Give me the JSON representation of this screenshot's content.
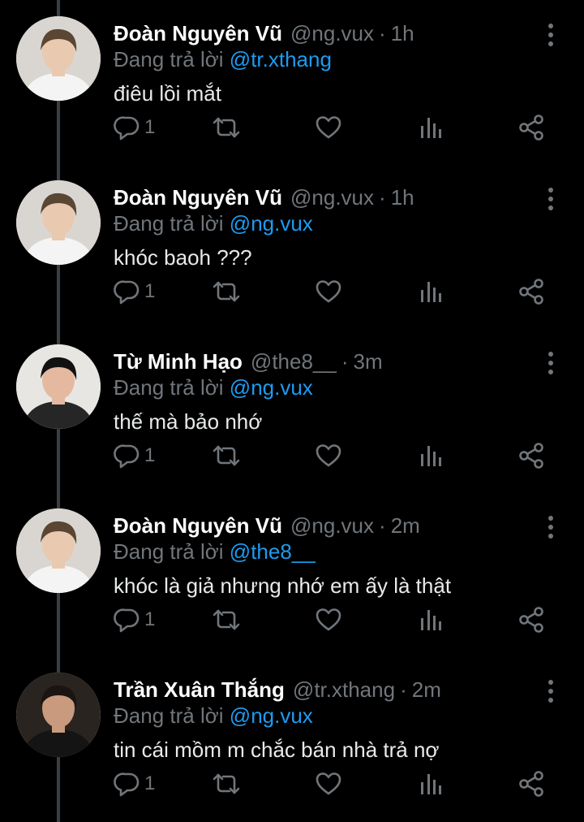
{
  "colors": {
    "background": "#000000",
    "accent": "#1d9bf0",
    "muted": "#71767b",
    "text": "#e7e9ea"
  },
  "icons": {
    "more": "more-vertical-icon",
    "reply": "reply-icon",
    "retweet": "retweet-icon",
    "like": "heart-icon",
    "stats": "analytics-icon",
    "share": "share-icon"
  },
  "reply_prefix": "Đang trả lời",
  "tweets": [
    {
      "name": "Đoàn Nguyên Vũ",
      "handle": "@ng.vux",
      "sep": "·",
      "time": "1h",
      "reply_to": "@tr.xthang",
      "text": "điêu lồi mắt",
      "reply_count": "1"
    },
    {
      "name": "Đoàn Nguyên Vũ",
      "handle": "@ng.vux",
      "sep": "·",
      "time": "1h",
      "reply_to": "@ng.vux",
      "text": "khóc baoh ???",
      "reply_count": "1"
    },
    {
      "name": "Từ Minh Hạo",
      "handle": "@the8__",
      "sep": "·",
      "time": "3m",
      "reply_to": "@ng.vux",
      "text": "thế mà bảo nhớ",
      "reply_count": "1"
    },
    {
      "name": "Đoàn Nguyên Vũ",
      "handle": "@ng.vux",
      "sep": "·",
      "time": "2m",
      "reply_to": "@the8__",
      "text": "khóc là giả nhưng nhớ em ấy là thật",
      "reply_count": "1"
    },
    {
      "name": "Trần Xuân Thắng",
      "handle": "@tr.xthang",
      "sep": "·",
      "time": "2m",
      "reply_to": "@ng.vux",
      "text": "tin cái mồm m chắc bán nhà trả nợ",
      "reply_count": "1"
    }
  ]
}
